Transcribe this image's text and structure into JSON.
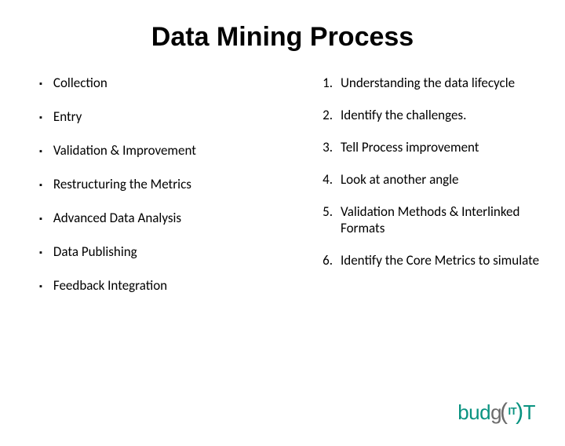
{
  "title": "Data  Mining Process",
  "left": {
    "items": [
      "Collection",
      "Entry",
      "Validation & Improvement",
      "Restructuring the Metrics",
      "Advanced Data Analysis",
      "Data Publishing",
      "Feedback Integration"
    ]
  },
  "right": {
    "items": [
      "Understanding the data lifecycle",
      "Identify the challenges.",
      "Tell Process improvement",
      "Look at another angle",
      "Validation Methods & Interlinked Formats",
      "Identify the Core Metrics to simulate"
    ]
  },
  "logo": {
    "part1": "bud",
    "part2": "g",
    "part3": "T",
    "it_label": "IT"
  }
}
